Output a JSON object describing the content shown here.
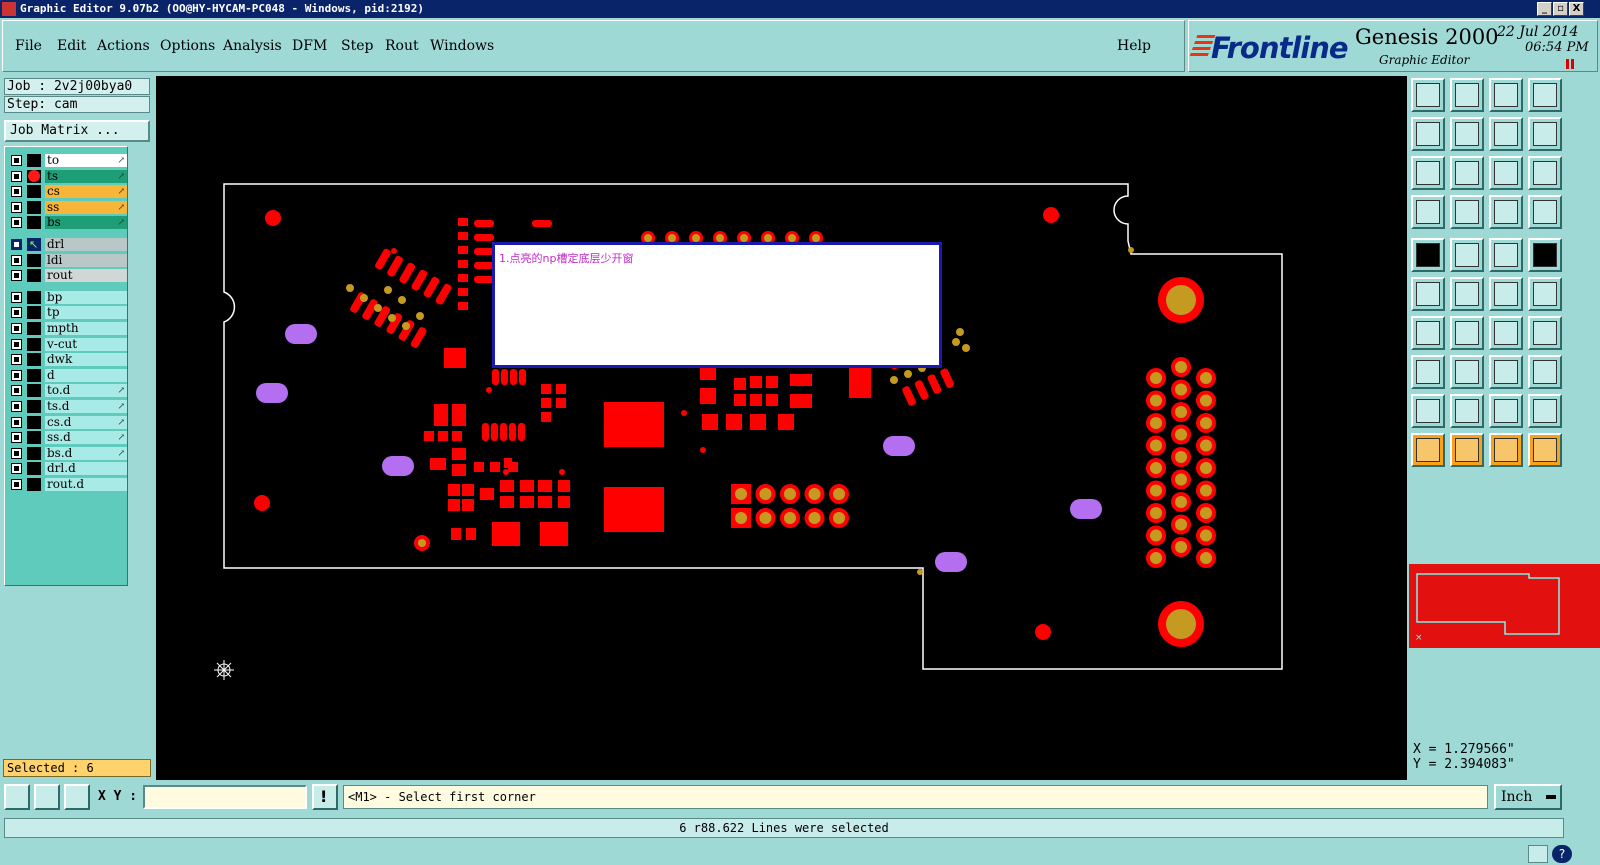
{
  "window": {
    "title": "Graphic Editor 9.07b2 (OO@HY-HYCAM-PC048 - Windows, pid:2192)",
    "min_label": "_",
    "max_label": "▫",
    "close_label": "X"
  },
  "menu": {
    "items": [
      "File",
      "Edit",
      "Actions",
      "Options",
      "Analysis",
      "DFM",
      "Step",
      "Rout",
      "Windows"
    ],
    "help": "Help"
  },
  "brand": {
    "logo": "Frontline",
    "product": "Genesis 2000",
    "subtitle": "Graphic Editor",
    "date": "22 Jul 2014",
    "time": "06:54 PM"
  },
  "left": {
    "job": "Job : 2v2j00bya0",
    "step": "Step: cam",
    "job_matrix": "Job Matrix ...",
    "layers": [
      {
        "name": "to",
        "color": "#ffffff",
        "marker": "none",
        "arrow": true
      },
      {
        "name": "ts",
        "color": "#1e9e77",
        "marker": "red-dot",
        "arrow": true
      },
      {
        "name": "cs",
        "color": "#f7b63a",
        "marker": "none",
        "arrow": true
      },
      {
        "name": "ss",
        "color": "#f7b63a",
        "marker": "none",
        "arrow": true
      },
      {
        "name": "bs",
        "color": "#1e9e77",
        "marker": "none",
        "arrow": true
      },
      {
        "name": "drl",
        "color": "#b9c7c6",
        "marker": "arrow",
        "arrow": false,
        "active": true
      },
      {
        "name": "ldi",
        "color": "#b9c7c6",
        "marker": "none",
        "arrow": false
      },
      {
        "name": "rout",
        "color": "#d0d7d6",
        "marker": "none",
        "arrow": false
      },
      {
        "name": "bp",
        "color": "#a8eae6",
        "marker": "none",
        "arrow": false
      },
      {
        "name": "tp",
        "color": "#a8eae6",
        "marker": "none",
        "arrow": false
      },
      {
        "name": "mpth",
        "color": "#a8eae6",
        "marker": "none",
        "arrow": false
      },
      {
        "name": "v-cut",
        "color": "#a8eae6",
        "marker": "none",
        "arrow": false
      },
      {
        "name": "dwk",
        "color": "#a8eae6",
        "marker": "none",
        "arrow": false
      },
      {
        "name": "d",
        "color": "#a8eae6",
        "marker": "none",
        "arrow": false
      },
      {
        "name": "to.d",
        "color": "#a8eae6",
        "marker": "none",
        "arrow": true
      },
      {
        "name": "ts.d",
        "color": "#a8eae6",
        "marker": "none",
        "arrow": true
      },
      {
        "name": "cs.d",
        "color": "#a8eae6",
        "marker": "none",
        "arrow": true
      },
      {
        "name": "ss.d",
        "color": "#a8eae6",
        "marker": "none",
        "arrow": true
      },
      {
        "name": "bs.d",
        "color": "#a8eae6",
        "marker": "none",
        "arrow": true
      },
      {
        "name": "drl.d",
        "color": "#a8eae6",
        "marker": "none",
        "arrow": false
      },
      {
        "name": "rout.d",
        "color": "#a8eae6",
        "marker": "none",
        "arrow": false
      }
    ],
    "selected": "Selected : 6"
  },
  "canvas": {
    "note": "1.点亮的np槽定底层少开窗"
  },
  "coords": {
    "x": "X = 1.279566\"",
    "y": "Y = 2.394083\""
  },
  "command": {
    "xy_label": "X Y :",
    "xy_value": "",
    "prompt": "<M1> - Select first corner",
    "unit": "Inch"
  },
  "status": {
    "message": "6 r88.622 Lines were selected"
  },
  "colors": {
    "copper": "#ff0000",
    "pad_ring": "#ff0000",
    "pad_center": "#c49a20",
    "np_slot": "#b36ff0",
    "outline": "#ffffff",
    "background": "#000000"
  }
}
